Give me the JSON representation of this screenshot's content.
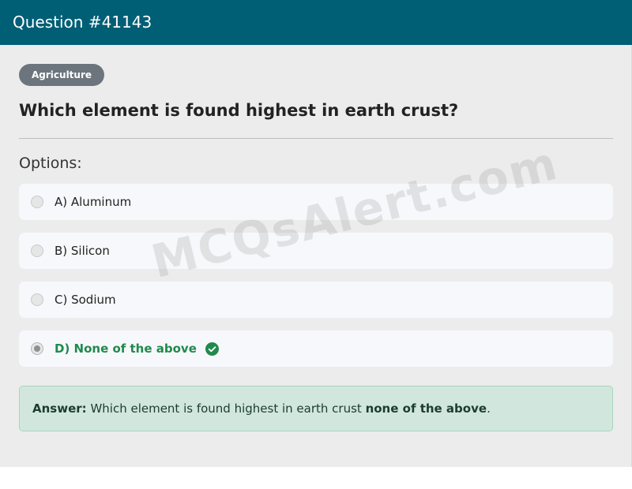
{
  "header": {
    "title": "Question #41143"
  },
  "category_badge": "Agriculture",
  "question": "Which element is found highest in earth crust?",
  "options_heading": "Options:",
  "options": [
    {
      "label": "A) Aluminum",
      "selected": false,
      "correct": false
    },
    {
      "label": "B) Silicon",
      "selected": false,
      "correct": false
    },
    {
      "label": "C) Sodium",
      "selected": false,
      "correct": false
    },
    {
      "label": "D) None of the above",
      "selected": true,
      "correct": true,
      "icon": "check-circle-icon"
    }
  ],
  "answer": {
    "prefix": "Answer:",
    "text": "Which element is found highest in earth crust",
    "highlight": "none of the above",
    "suffix": "."
  },
  "watermark": "MCQsAlert.com",
  "colors": {
    "header_bg": "#005e75",
    "correct_green": "#1f8a4c",
    "answer_bg": "#d1e7dd",
    "badge_bg": "#6c757d"
  }
}
